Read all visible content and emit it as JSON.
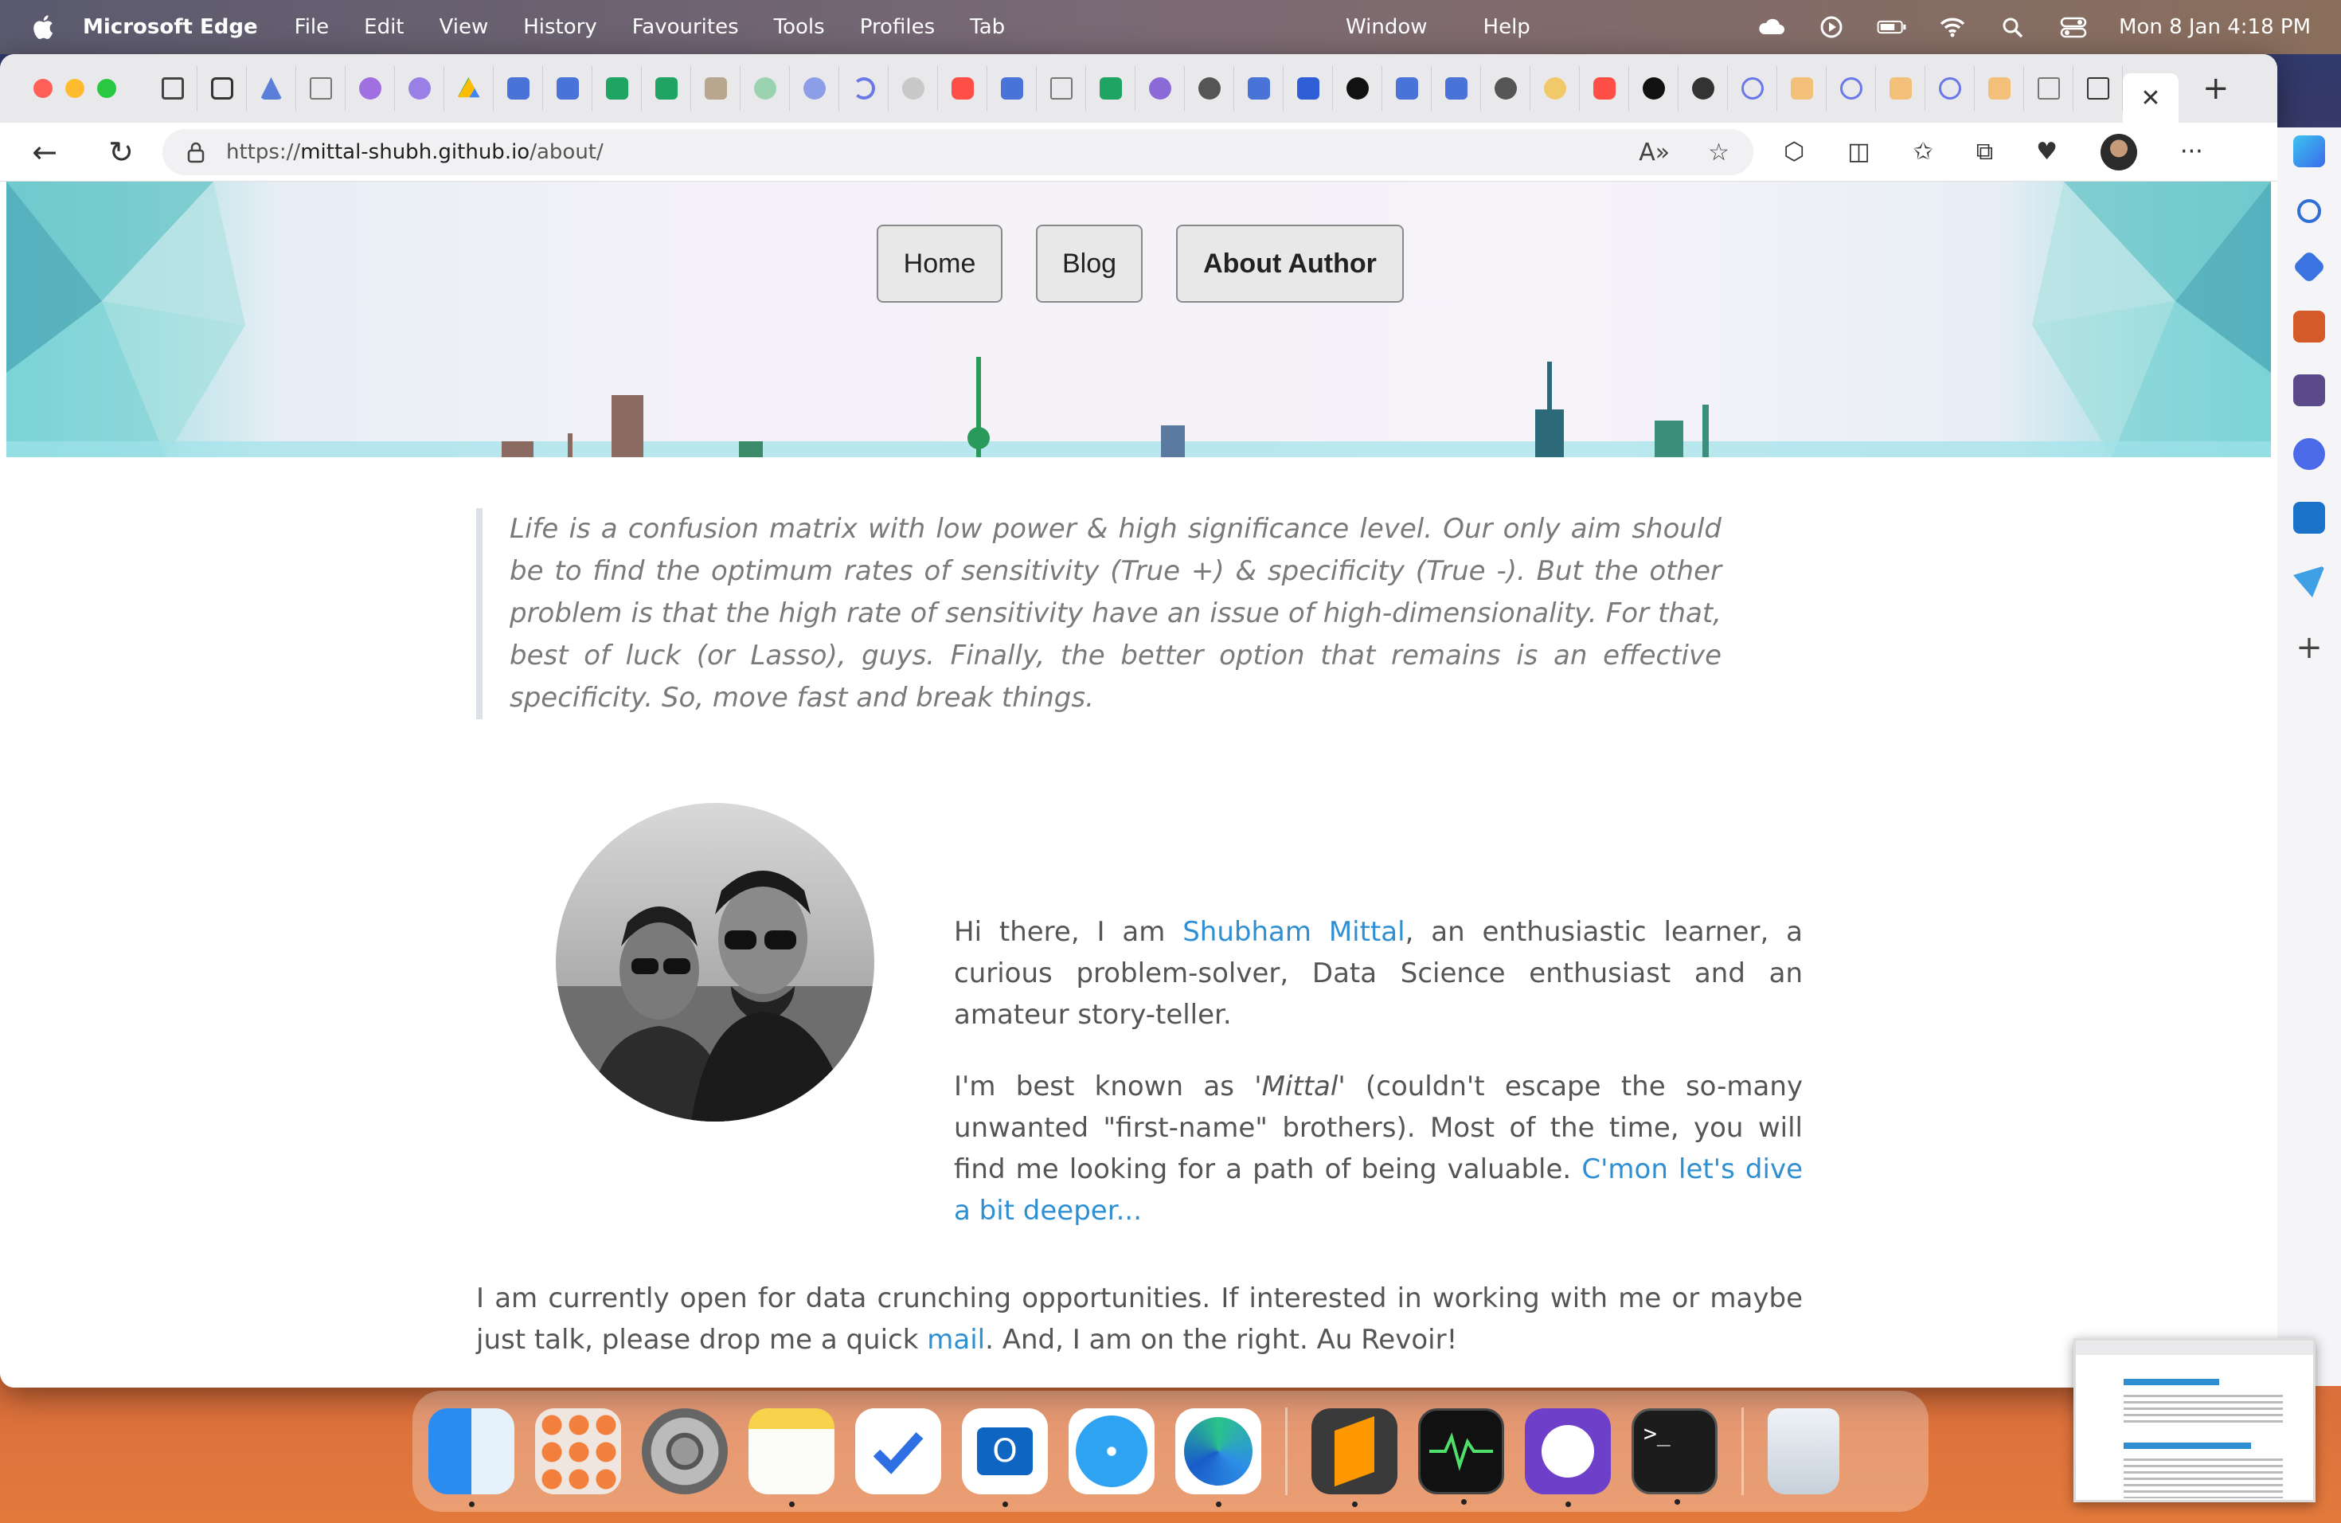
{
  "menubar": {
    "app_name": "Microsoft Edge",
    "items": [
      "File",
      "Edit",
      "View",
      "History",
      "Favourites",
      "Tools",
      "Profiles",
      "Tab"
    ],
    "center_items": [
      "Window",
      "Help"
    ],
    "clock": "Mon 8 Jan  4:18 PM"
  },
  "browser": {
    "url_prefix": "https://",
    "url_host": "mittal-shubh.github.io",
    "url_path": "/about/"
  },
  "site": {
    "nav": [
      "Home",
      "Blog",
      "About Author"
    ],
    "quote": "Life is a confusion matrix with low power & high significance level. Our only aim should be to find the optimum rates of sensitivity (True +) & specificity (True -). But the other problem is that the high rate of sensitivity have an issue of high-dimensionality. For that, best of luck (or Lasso), guys. Finally, the better option that remains is an effective specificity. So, move fast and break things.",
    "p1_before": "Hi there, I am ",
    "p1_link": "Shubham Mittal",
    "p1_after": ", an enthusiastic learner, a curious problem-solver, Data Science enthusiast and an amateur story-teller.",
    "p2_before": "I'm best known as ",
    "p2_em": "'Mittal'",
    "p2_middle": " (couldn't escape the so-many unwanted \"first-name\" brothers). Most of the time, you will find me looking for a path of being valuable. ",
    "p2_link": "C'mon let's dive a bit deeper...",
    "p3_before": "I am currently open for data crunching opportunities. If interested in working with me or maybe just talk, please drop me a quick ",
    "p3_link": "mail",
    "p3_after": ". And, I am on the right. Au Revoir!"
  },
  "dock": [
    "finder-icon",
    "launchpad-icon",
    "system-settings-icon",
    "notes-icon",
    "todo-icon",
    "outlook-icon",
    "safari-icon",
    "edge-icon",
    "sublime-text-icon",
    "activity-monitor-icon",
    "github-desktop-icon",
    "terminal-icon",
    "trash-icon"
  ]
}
